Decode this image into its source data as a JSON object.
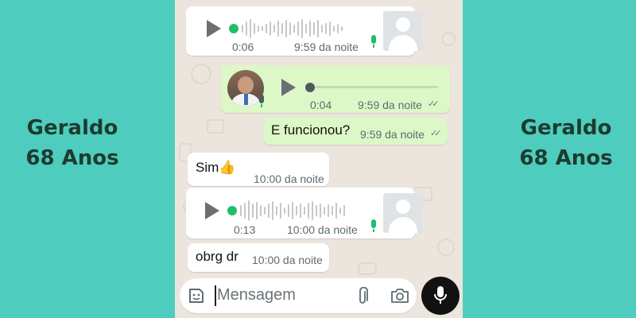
{
  "side_caption": {
    "name": "Geraldo",
    "age": "68 Anos"
  },
  "chat": {
    "messages": [
      {
        "kind": "voice",
        "direction": "incoming",
        "duration": "0:06",
        "time": "9:59 da noite"
      },
      {
        "kind": "voice",
        "direction": "outgoing",
        "duration": "0:04",
        "time": "9:59 da noite",
        "status": "read"
      },
      {
        "kind": "text",
        "direction": "outgoing",
        "text": "E funcionou?",
        "time": "9:59 da noite",
        "status": "read"
      },
      {
        "kind": "text",
        "direction": "incoming",
        "text": "Sim👍",
        "time": "10:00 da noite"
      },
      {
        "kind": "voice",
        "direction": "incoming",
        "duration": "0:13",
        "time": "10:00 da noite"
      },
      {
        "kind": "text",
        "direction": "incoming",
        "text": "obrg dr",
        "time": "10:00 da noite"
      }
    ]
  },
  "composer": {
    "placeholder": "Mensagem"
  },
  "icons": {
    "emoji": "sticker-icon",
    "attach": "paperclip-icon",
    "camera": "camera-icon",
    "voice": "mic-icon",
    "play": "play-icon",
    "read_status": "double-check-icon"
  },
  "colors": {
    "page_background": "#4ecdbf",
    "caption_text": "#1d3b2f",
    "chat_wallpaper": "#ece5dd",
    "incoming_bubble": "#ffffff",
    "outgoing_bubble": "#dcf8c6",
    "accent_green": "#1fbf6a",
    "mic_button": "#111111"
  }
}
